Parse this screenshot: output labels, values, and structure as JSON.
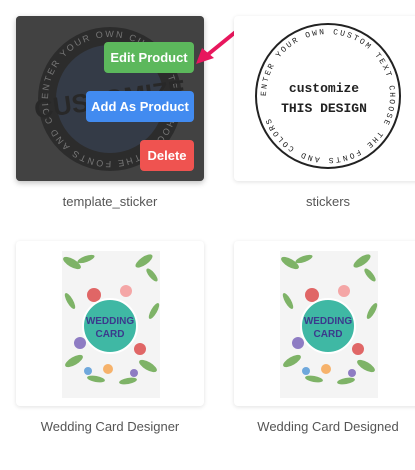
{
  "templates": [
    {
      "caption": "template_sticker",
      "sticker_text": "CUSTOMIZE",
      "ring_text": "ENTER YOUR OWN CUSTOM TEXT CHOOSE THE FONTS AND COLORS",
      "actions": {
        "edit": "Edit Product",
        "add": "Add As Product",
        "delete": "Delete"
      }
    },
    {
      "caption": "stickers",
      "line1": "customize",
      "line2": "THIS DESIGN",
      "ring_text": "ENTER YOUR OWN CUSTOM TEXT CHOOSE THE FONTS AND COLORS"
    },
    {
      "caption": "Wedding Card Designer",
      "card_line1": "WEDDING",
      "card_line2": "CARD"
    },
    {
      "caption": "Wedding Card Designed",
      "card_line1": "WEDDING",
      "card_line2": "CARD"
    }
  ],
  "colors": {
    "edit": "#5cb85c",
    "add": "#428bf0",
    "delete": "#ef5350",
    "pointer": "#e8175d",
    "wedding_badge": "#3fb8a4"
  }
}
